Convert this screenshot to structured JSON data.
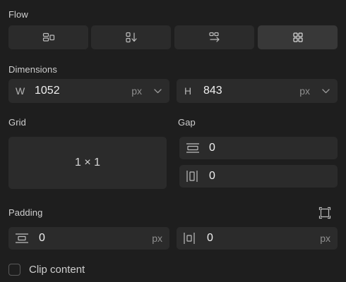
{
  "flow": {
    "label": "Flow",
    "options": [
      {
        "icon": "flow-horizontal-icon"
      },
      {
        "icon": "flow-vertical-icon"
      },
      {
        "icon": "flow-wrap-icon"
      },
      {
        "icon": "grid-layout-icon",
        "active": true
      }
    ]
  },
  "dimensions": {
    "label": "Dimensions",
    "width": {
      "prefix": "W",
      "value": "1052",
      "unit": "px"
    },
    "height": {
      "prefix": "H",
      "value": "843",
      "unit": "px"
    }
  },
  "grid": {
    "label": "Grid",
    "value": "1 × 1"
  },
  "gap": {
    "label": "Gap",
    "row": {
      "icon": "row-gap-icon",
      "value": "0"
    },
    "column": {
      "icon": "column-gap-icon",
      "value": "0"
    }
  },
  "padding": {
    "label": "Padding",
    "vertical": {
      "icon": "vertical-padding-icon",
      "value": "0",
      "unit": "px"
    },
    "horizontal": {
      "icon": "horizontal-padding-icon",
      "value": "0",
      "unit": "px"
    }
  },
  "clip": {
    "label": "Clip content",
    "checked": false
  },
  "colors": {
    "background": "#1e1e1e",
    "field": "#2b2b2b",
    "active": "#383838"
  }
}
